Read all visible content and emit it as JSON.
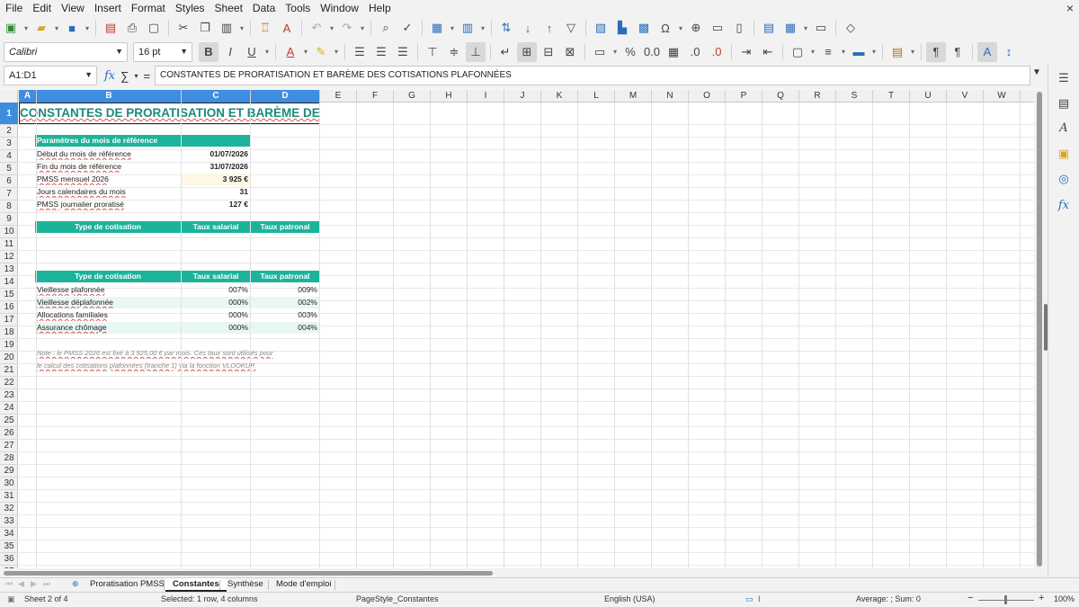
{
  "menu": [
    "File",
    "Edit",
    "View",
    "Insert",
    "Format",
    "Styles",
    "Sheet",
    "Data",
    "Tools",
    "Window",
    "Help"
  ],
  "close_label": "×",
  "font": {
    "name": "Calibri",
    "size": "16 pt"
  },
  "formula": {
    "namebox": "A1:D1",
    "content": "CONSTANTES DE PRORATISATION ET BARÈME DES COTISATIONS PLAFONNÉES",
    "fx": "fx",
    "sigma": "∑",
    "equals": "="
  },
  "columns": [
    "A",
    "B",
    "C",
    "D",
    "E",
    "F",
    "G",
    "H",
    "I",
    "J",
    "K",
    "L",
    "M",
    "N",
    "O",
    "P",
    "Q",
    "R",
    "S",
    "T",
    "U",
    "V",
    "W"
  ],
  "rows": [
    "1",
    "2",
    "3",
    "4",
    "5",
    "6",
    "7",
    "8",
    "9",
    "10",
    "11",
    "12",
    "13",
    "14",
    "15",
    "16",
    "17",
    "18",
    "19",
    "20",
    "21",
    "22",
    "23",
    "24",
    "25",
    "26",
    "27",
    "28",
    "29",
    "30",
    "31",
    "32",
    "33",
    "34",
    "35",
    "36",
    "37"
  ],
  "sheet": {
    "title": "CONSTANTES DE PRORATISATION ET BARÈME DES COTISATI",
    "params_header": "Paramètres du mois de référence",
    "params": [
      {
        "label": "Début du mois de référence",
        "value": "01/07/2026"
      },
      {
        "label": "Fin du mois de référence",
        "value": "31/07/2026"
      },
      {
        "label": "PMSS mensuel 2026",
        "value": "3 925 €"
      },
      {
        "label": "Jours calendaires du mois",
        "value": "31"
      },
      {
        "label": "PMSS journalier proratisé",
        "value": "127 €"
      }
    ],
    "table1_headers": [
      "Type de cotisation",
      "Taux salarial",
      "Taux patronal"
    ],
    "table2_headers": [
      "Type de cotisation",
      "Taux salarial",
      "Taux patronal"
    ],
    "rates": [
      {
        "type": "Vieillesse plafonnée",
        "sal": "007%",
        "pat": "009%"
      },
      {
        "type": "Vieillesse déplafonnée",
        "sal": "000%",
        "pat": "002%"
      },
      {
        "type": "Allocations familiales",
        "sal": "000%",
        "pat": "003%"
      },
      {
        "type": "Assurance chômage",
        "sal": "000%",
        "pat": "004%"
      }
    ],
    "note_line1": "Note : le PMSS 2026 est fixé à 3 925,00 € par mois. Ces taux sont utilisés pour",
    "note_line2": "le calcul des cotisations plafonnées (tranche 1) via la fonction VLOOKUP."
  },
  "tabs": [
    "Proratisation PMSS",
    "Constantes",
    "Synthèse",
    "Mode d'emploi"
  ],
  "tab_add": "⊕",
  "status": {
    "sheet": "Sheet 2 of 4",
    "selection": "Selected: 1 row, 4 columns",
    "page_style": "PageStyle_Constantes",
    "language": "English (USA)",
    "summary": "Average: ; Sum: 0",
    "zoom": "100%",
    "zoom_minus": "−",
    "zoom_plus": "+"
  }
}
